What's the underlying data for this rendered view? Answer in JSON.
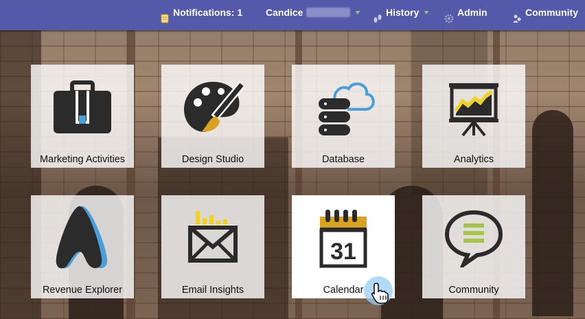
{
  "topbar": {
    "notifications_label": "Notifications: 1",
    "user_name": "Candice",
    "history_label": "History",
    "admin_label": "Admin",
    "community_label": "Community",
    "bar_color": "#5559a9"
  },
  "tiles": [
    {
      "label": "Marketing Activities",
      "icon": "briefcase-icon"
    },
    {
      "label": "Design Studio",
      "icon": "palette-icon"
    },
    {
      "label": "Database",
      "icon": "database-cloud-icon"
    },
    {
      "label": "Analytics",
      "icon": "chart-easel-icon"
    },
    {
      "label": "Revenue Explorer",
      "icon": "revenue-explorer-icon"
    },
    {
      "label": "Email Insights",
      "icon": "email-insights-icon"
    },
    {
      "label": "Calendar",
      "icon": "calendar-icon",
      "day": "31"
    },
    {
      "label": "Community",
      "icon": "speech-bubble-icon"
    }
  ],
  "colors": {
    "accent_gold": "#d9a21f",
    "icon_dark": "#2b2b2b",
    "cloud_blue": "#4a9fd8",
    "yellow": "#f2d21a",
    "green": "#a7c44a"
  }
}
